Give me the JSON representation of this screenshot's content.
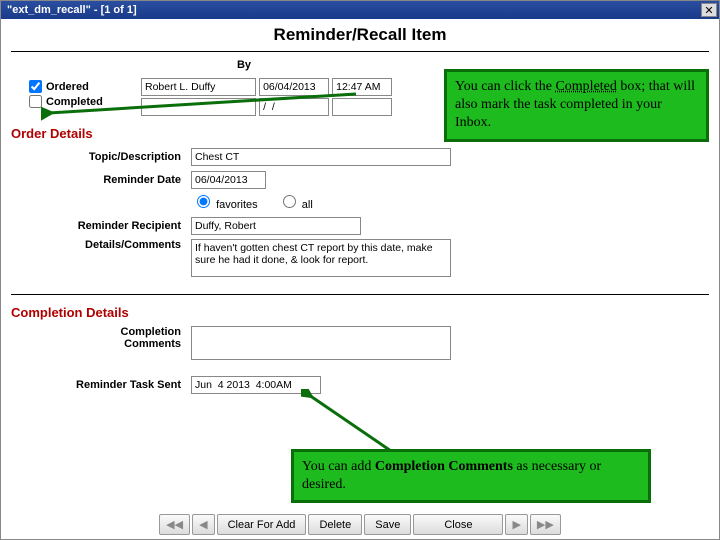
{
  "titlebar": {
    "text": "\"ext_dm_recall\" - [1 of 1]"
  },
  "pageTitle": "Reminder/Recall Item",
  "byLabel": "By",
  "ordered": {
    "label": "Ordered",
    "by": "Robert L. Duffy",
    "date": "06/04/2013",
    "time": "12:47 AM"
  },
  "completed": {
    "label": "Completed",
    "date": "/  /"
  },
  "orderDetailsHead": "Order Details",
  "topic": {
    "label": "Topic/Description",
    "value": "Chest CT"
  },
  "reminderDate": {
    "label": "Reminder Date",
    "value": "06/04/2013"
  },
  "radios": {
    "fav": "favorites",
    "all": "all"
  },
  "recipient": {
    "label": "Reminder Recipient",
    "value": "Duffy, Robert"
  },
  "details": {
    "label": "Details/Comments",
    "value": "If haven't gotten chest CT report by this date, make sure he had it done, & look for report."
  },
  "completionHead": "Completion Details",
  "completionComments": {
    "label1": "Completion",
    "label2": "Comments"
  },
  "taskSent": {
    "label": "Reminder Task Sent",
    "value": "Jun  4 2013  4:00AM"
  },
  "callout1": {
    "a": "You can click the ",
    "b": "Completed",
    "c": " box; that will also mark the task completed in your Inbox."
  },
  "callout2": {
    "a": "You can add ",
    "b": "Completion Comments",
    "c": " as necessary or desired."
  },
  "buttons": {
    "prevAll": "◀◀",
    "prev": "◀",
    "clear": "Clear For Add",
    "delete": "Delete",
    "save": "Save",
    "close": "Close",
    "next": "▶",
    "nextAll": "▶▶"
  }
}
